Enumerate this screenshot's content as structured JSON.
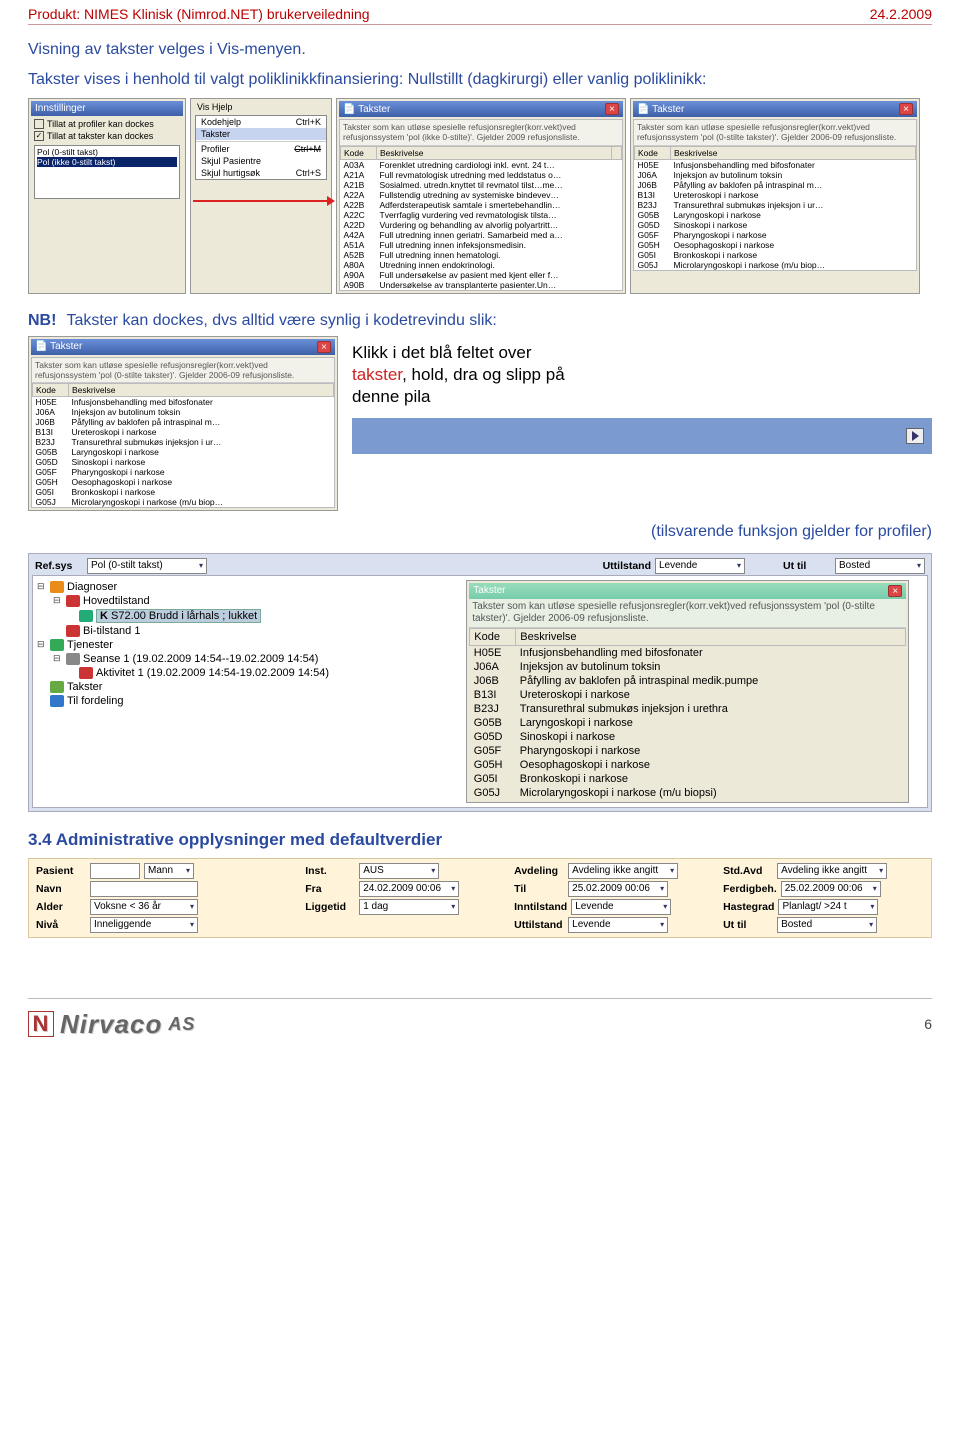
{
  "header": {
    "product": "Produkt: NIMES Klinisk (Nimrod.NET) brukerveiledning",
    "date": "24.2.2009"
  },
  "intro": {
    "line1": "Visning av takster velges i Vis-menyen.",
    "line2": "Takster vises i henhold til valgt poliklinikkfinansiering: Nullstillt (dagkirurgi) eller vanlig poliklinikk:"
  },
  "settings": {
    "title": "Innstillinger",
    "chk1": "Tillat at profiler kan dockes",
    "chk2": "Tillat at takster kan dockes",
    "list": [
      "Pol (0-stilt takst)",
      "Pol (ikke 0-stilt takst)"
    ]
  },
  "menu": {
    "bar": "Vis  Hjelp",
    "items": [
      {
        "label": "Kodehjelp",
        "accel": "Ctrl+K"
      },
      {
        "label": "Takster",
        "accel": ""
      },
      {
        "label": "Profiler",
        "accel": "Ctrl+M"
      },
      {
        "label": "Skjul Pasientre",
        "accel": ""
      },
      {
        "label": "Skjul hurtigsøk",
        "accel": "Ctrl+S"
      }
    ]
  },
  "takster_a": {
    "title": "Takster",
    "desc": "Takster som kan utløse spesielle refusjonsregler(korr.vekt)ved refusjonssystem 'pol (ikke 0-stilte)'. Gjelder 2009 refusjonsliste.",
    "th_code": "Kode",
    "th_desc": "Beskrivelse",
    "rows": [
      [
        "A03A",
        "Forenklet utredning cardiologi inkl. evnt. 24 t…"
      ],
      [
        "A21A",
        "Full revmatologisk utredning med leddstatus o…"
      ],
      [
        "A21B",
        "Sosialmed. utredn.knyttet til revmatol tilst…me…"
      ],
      [
        "A22A",
        "Fullstendig utredning av systemiske bindevev…"
      ],
      [
        "A22B",
        "Adferdsterapeutisk samtale i smertebehandlin…"
      ],
      [
        "A22C",
        "Tverrfaglig vurdering ved revmatologisk tilsta…"
      ],
      [
        "A22D",
        "Vurdering og behandling av alvorlig polyartritt…"
      ],
      [
        "A42A",
        "Full utredning innen geriatri. Samarbeid med a…"
      ],
      [
        "A51A",
        "Full utredning innen infeksjonsmedisin."
      ],
      [
        "A52B",
        "Full utredning innen hematologi."
      ],
      [
        "A80A",
        "Utredning innen endokrinologi."
      ],
      [
        "A90A",
        "Full undersøkelse av pasient med kjent eller f…"
      ],
      [
        "A90B",
        "Undersøkelse av transplanterte pasienter.Un…"
      ]
    ]
  },
  "takster_b": {
    "title": "Takster",
    "desc": "Takster som kan utløse spesielle refusjonsregler(korr.vekt)ved refusjonssystem 'pol (0-stilte takster)'. Gjelder 2006-09 refusjonsliste.",
    "th_code": "Kode",
    "th_desc": "Beskrivelse",
    "rows": [
      [
        "H05E",
        "Infusjonsbehandling med bifosfonater"
      ],
      [
        "J06A",
        "Injeksjon av butolinum toksin"
      ],
      [
        "J06B",
        "Påfylling av baklofen på intraspinal m…"
      ],
      [
        "B13I",
        "Ureteroskopi i narkose"
      ],
      [
        "B23J",
        "Transurethral submukøs injeksjon i ur…"
      ],
      [
        "G05B",
        "Laryngoskopi i narkose"
      ],
      [
        "G05D",
        "Sinoskopi i narkose"
      ],
      [
        "G05F",
        "Pharyngoskopi i narkose"
      ],
      [
        "G05H",
        "Oesophagoskopi i narkose"
      ],
      [
        "G05I",
        "Bronkoskopi i narkose"
      ],
      [
        "G05J",
        "Microlaryngoskopi i narkose (m/u biop…"
      ]
    ]
  },
  "nb": {
    "label": "NB!",
    "text": "Takster kan dockes, dvs alltid være synlig i kodetrevindu slik:"
  },
  "callout": {
    "l1": "Klikk i det blå feltet over",
    "l2a": "takster",
    "l2b": ", hold, dra og slipp på",
    "l3": "denne pila"
  },
  "func_note": "(tilsvarende funksjon gjelder for profiler)",
  "ref_row": {
    "refsys_lbl": "Ref.sys",
    "refsys_val": "Pol (0-stilt takst)",
    "uttilstand_lbl": "Uttilstand",
    "uttilstand_val": "Levende",
    "uttil_lbl": "Ut til",
    "uttil_val": "Bosted"
  },
  "tree": {
    "diagnoser": "Diagnoser",
    "hovedtilstand": "Hovedtilstand",
    "code_k": "K",
    "code_text": "S72.00 Brudd i lårhals ; lukket",
    "bitilstand": "Bi-tilstand 1",
    "tjenester": "Tjenester",
    "seanse": "Seanse 1 (19.02.2009 14:54--19.02.2009 14:54)",
    "aktivitet": "Aktivitet 1 (19.02.2009 14:54-19.02.2009 14:54)",
    "takster": "Takster",
    "tilfordeling": "Til fordeling"
  },
  "takster_big": {
    "title": "Takster",
    "desc": "Takster som kan utløse spesielle refusjonsregler(korr.vekt)ved refusjonssystem 'pol (0-stilte takster)'. Gjelder 2006-09 refusjonsliste.",
    "th_code": "Kode",
    "th_desc": "Beskrivelse",
    "rows": [
      [
        "H05E",
        "Infusjonsbehandling med bifosfonater"
      ],
      [
        "J06A",
        "Injeksjon av butolinum toksin"
      ],
      [
        "J06B",
        "Påfylling av baklofen på intraspinal medik.pumpe"
      ],
      [
        "B13I",
        "Ureteroskopi i narkose"
      ],
      [
        "B23J",
        "Transurethral submukøs injeksjon i urethra"
      ],
      [
        "G05B",
        "Laryngoskopi i narkose"
      ],
      [
        "G05D",
        "Sinoskopi i narkose"
      ],
      [
        "G05F",
        "Pharyngoskopi i narkose"
      ],
      [
        "G05H",
        "Oesophagoskopi i narkose"
      ],
      [
        "G05I",
        "Bronkoskopi i narkose"
      ],
      [
        "G05J",
        "Microlaryngoskopi i narkose (m/u biopsi)"
      ]
    ]
  },
  "section34": "3.4   Administrative opplysninger med defaultverdier",
  "admin": {
    "r1": {
      "pasient_lbl": "Pasient",
      "pasient_val": "",
      "kjonn_val": "Mann",
      "inst_lbl": "Inst.",
      "inst_val": "AUS",
      "avdeling_lbl": "Avdeling",
      "avdeling_val": "Avdeling ikke angitt",
      "stdavd_lbl": "Std.Avd",
      "stdavd_val": "Avdeling ikke angitt"
    },
    "r2": {
      "navn_lbl": "Navn",
      "navn_val": "",
      "fra_lbl": "Fra",
      "fra_val": "24.02.2009 00:06",
      "til_lbl": "Til",
      "til_val": "25.02.2009 00:06",
      "ferdig_lbl": "Ferdigbeh.",
      "ferdig_val": "25.02.2009 00:06"
    },
    "r3": {
      "alder_lbl": "Alder",
      "alder_val": "Voksne < 36 år",
      "ligge_lbl": "Liggetid",
      "ligge_val": "1 dag",
      "inntil_lbl": "Inntilstand",
      "inntil_val": "Levende",
      "haste_lbl": "Hastegrad",
      "haste_val": "Planlagt/ >24 t"
    },
    "r4": {
      "niva_lbl": "Nivå",
      "niva_val": "Inneliggende",
      "uttilstand_lbl": "Uttilstand",
      "uttilstand_val": "Levende",
      "uttil_lbl": "Ut til",
      "uttil_val": "Bosted"
    }
  },
  "footer": {
    "logo": "Nirvaco",
    "as": "AS",
    "page": "6"
  }
}
